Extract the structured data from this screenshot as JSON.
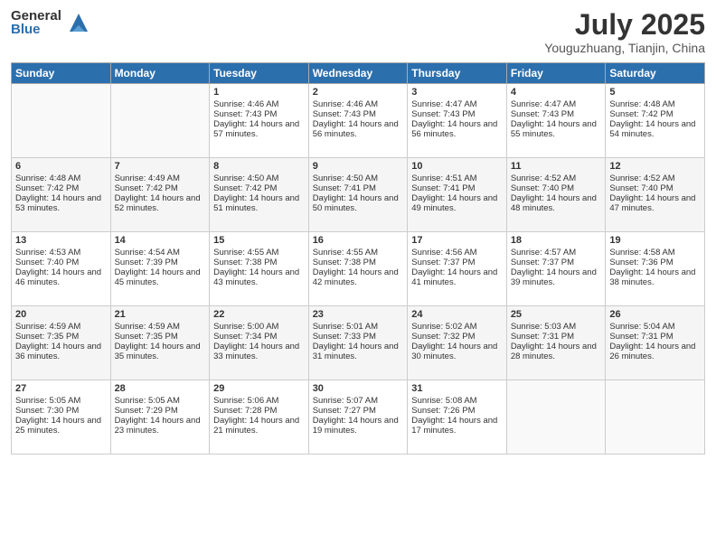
{
  "logo": {
    "general": "General",
    "blue": "Blue"
  },
  "title": "July 2025",
  "location": "Youguzhuang, Tianjin, China",
  "weekdays": [
    "Sunday",
    "Monday",
    "Tuesday",
    "Wednesday",
    "Thursday",
    "Friday",
    "Saturday"
  ],
  "weeks": [
    [
      {
        "day": "",
        "sunrise": "",
        "sunset": "",
        "daylight": ""
      },
      {
        "day": "",
        "sunrise": "",
        "sunset": "",
        "daylight": ""
      },
      {
        "day": "1",
        "sunrise": "Sunrise: 4:46 AM",
        "sunset": "Sunset: 7:43 PM",
        "daylight": "Daylight: 14 hours and 57 minutes."
      },
      {
        "day": "2",
        "sunrise": "Sunrise: 4:46 AM",
        "sunset": "Sunset: 7:43 PM",
        "daylight": "Daylight: 14 hours and 56 minutes."
      },
      {
        "day": "3",
        "sunrise": "Sunrise: 4:47 AM",
        "sunset": "Sunset: 7:43 PM",
        "daylight": "Daylight: 14 hours and 56 minutes."
      },
      {
        "day": "4",
        "sunrise": "Sunrise: 4:47 AM",
        "sunset": "Sunset: 7:43 PM",
        "daylight": "Daylight: 14 hours and 55 minutes."
      },
      {
        "day": "5",
        "sunrise": "Sunrise: 4:48 AM",
        "sunset": "Sunset: 7:42 PM",
        "daylight": "Daylight: 14 hours and 54 minutes."
      }
    ],
    [
      {
        "day": "6",
        "sunrise": "Sunrise: 4:48 AM",
        "sunset": "Sunset: 7:42 PM",
        "daylight": "Daylight: 14 hours and 53 minutes."
      },
      {
        "day": "7",
        "sunrise": "Sunrise: 4:49 AM",
        "sunset": "Sunset: 7:42 PM",
        "daylight": "Daylight: 14 hours and 52 minutes."
      },
      {
        "day": "8",
        "sunrise": "Sunrise: 4:50 AM",
        "sunset": "Sunset: 7:42 PM",
        "daylight": "Daylight: 14 hours and 51 minutes."
      },
      {
        "day": "9",
        "sunrise": "Sunrise: 4:50 AM",
        "sunset": "Sunset: 7:41 PM",
        "daylight": "Daylight: 14 hours and 50 minutes."
      },
      {
        "day": "10",
        "sunrise": "Sunrise: 4:51 AM",
        "sunset": "Sunset: 7:41 PM",
        "daylight": "Daylight: 14 hours and 49 minutes."
      },
      {
        "day": "11",
        "sunrise": "Sunrise: 4:52 AM",
        "sunset": "Sunset: 7:40 PM",
        "daylight": "Daylight: 14 hours and 48 minutes."
      },
      {
        "day": "12",
        "sunrise": "Sunrise: 4:52 AM",
        "sunset": "Sunset: 7:40 PM",
        "daylight": "Daylight: 14 hours and 47 minutes."
      }
    ],
    [
      {
        "day": "13",
        "sunrise": "Sunrise: 4:53 AM",
        "sunset": "Sunset: 7:40 PM",
        "daylight": "Daylight: 14 hours and 46 minutes."
      },
      {
        "day": "14",
        "sunrise": "Sunrise: 4:54 AM",
        "sunset": "Sunset: 7:39 PM",
        "daylight": "Daylight: 14 hours and 45 minutes."
      },
      {
        "day": "15",
        "sunrise": "Sunrise: 4:55 AM",
        "sunset": "Sunset: 7:38 PM",
        "daylight": "Daylight: 14 hours and 43 minutes."
      },
      {
        "day": "16",
        "sunrise": "Sunrise: 4:55 AM",
        "sunset": "Sunset: 7:38 PM",
        "daylight": "Daylight: 14 hours and 42 minutes."
      },
      {
        "day": "17",
        "sunrise": "Sunrise: 4:56 AM",
        "sunset": "Sunset: 7:37 PM",
        "daylight": "Daylight: 14 hours and 41 minutes."
      },
      {
        "day": "18",
        "sunrise": "Sunrise: 4:57 AM",
        "sunset": "Sunset: 7:37 PM",
        "daylight": "Daylight: 14 hours and 39 minutes."
      },
      {
        "day": "19",
        "sunrise": "Sunrise: 4:58 AM",
        "sunset": "Sunset: 7:36 PM",
        "daylight": "Daylight: 14 hours and 38 minutes."
      }
    ],
    [
      {
        "day": "20",
        "sunrise": "Sunrise: 4:59 AM",
        "sunset": "Sunset: 7:35 PM",
        "daylight": "Daylight: 14 hours and 36 minutes."
      },
      {
        "day": "21",
        "sunrise": "Sunrise: 4:59 AM",
        "sunset": "Sunset: 7:35 PM",
        "daylight": "Daylight: 14 hours and 35 minutes."
      },
      {
        "day": "22",
        "sunrise": "Sunrise: 5:00 AM",
        "sunset": "Sunset: 7:34 PM",
        "daylight": "Daylight: 14 hours and 33 minutes."
      },
      {
        "day": "23",
        "sunrise": "Sunrise: 5:01 AM",
        "sunset": "Sunset: 7:33 PM",
        "daylight": "Daylight: 14 hours and 31 minutes."
      },
      {
        "day": "24",
        "sunrise": "Sunrise: 5:02 AM",
        "sunset": "Sunset: 7:32 PM",
        "daylight": "Daylight: 14 hours and 30 minutes."
      },
      {
        "day": "25",
        "sunrise": "Sunrise: 5:03 AM",
        "sunset": "Sunset: 7:31 PM",
        "daylight": "Daylight: 14 hours and 28 minutes."
      },
      {
        "day": "26",
        "sunrise": "Sunrise: 5:04 AM",
        "sunset": "Sunset: 7:31 PM",
        "daylight": "Daylight: 14 hours and 26 minutes."
      }
    ],
    [
      {
        "day": "27",
        "sunrise": "Sunrise: 5:05 AM",
        "sunset": "Sunset: 7:30 PM",
        "daylight": "Daylight: 14 hours and 25 minutes."
      },
      {
        "day": "28",
        "sunrise": "Sunrise: 5:05 AM",
        "sunset": "Sunset: 7:29 PM",
        "daylight": "Daylight: 14 hours and 23 minutes."
      },
      {
        "day": "29",
        "sunrise": "Sunrise: 5:06 AM",
        "sunset": "Sunset: 7:28 PM",
        "daylight": "Daylight: 14 hours and 21 minutes."
      },
      {
        "day": "30",
        "sunrise": "Sunrise: 5:07 AM",
        "sunset": "Sunset: 7:27 PM",
        "daylight": "Daylight: 14 hours and 19 minutes."
      },
      {
        "day": "31",
        "sunrise": "Sunrise: 5:08 AM",
        "sunset": "Sunset: 7:26 PM",
        "daylight": "Daylight: 14 hours and 17 minutes."
      },
      {
        "day": "",
        "sunrise": "",
        "sunset": "",
        "daylight": ""
      },
      {
        "day": "",
        "sunrise": "",
        "sunset": "",
        "daylight": ""
      }
    ]
  ]
}
